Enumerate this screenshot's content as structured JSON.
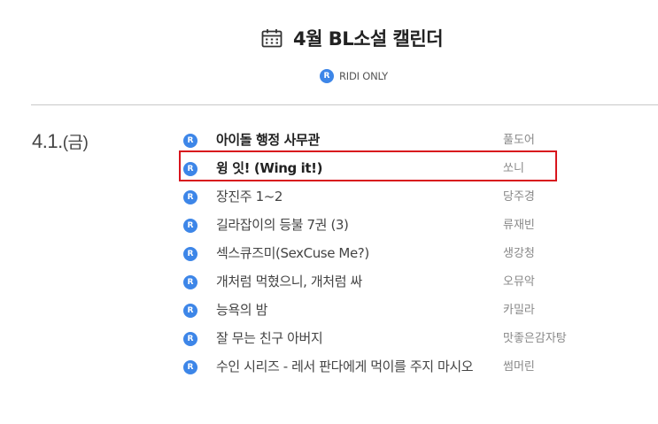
{
  "header": {
    "title": "4월 BL소설 캘린더",
    "badge_letter": "R",
    "subtitle": "RIDI ONLY"
  },
  "date": {
    "day": "4.1.",
    "weekday": "(금)"
  },
  "colors": {
    "badge_blue": "#3d86e8",
    "highlight_red": "#d8151d"
  },
  "books": [
    {
      "title": "아이돌 행정 사무관",
      "author": "풀도어",
      "bold": true
    },
    {
      "title": "윙 잇! (Wing it!)",
      "author": "쏘니",
      "bold": true,
      "highlighted": true
    },
    {
      "title": "장진주 1~2",
      "author": "당주경"
    },
    {
      "title": "길라잡이의 등불 7권 (3)",
      "author": "류재빈"
    },
    {
      "title": "섹스큐즈미(SexCuse Me?)",
      "author": "생강청"
    },
    {
      "title": "개처럼 먹혔으니, 개처럼 싸",
      "author": "오뮤악"
    },
    {
      "title": "능욕의 밤",
      "author": "카밀라"
    },
    {
      "title": "잘 무는 친구 아버지",
      "author": "맛좋은감자탕"
    },
    {
      "title": "수인 시리즈 - 레서 판다에게 먹이를 주지 마시오",
      "author": "썸머린"
    }
  ]
}
